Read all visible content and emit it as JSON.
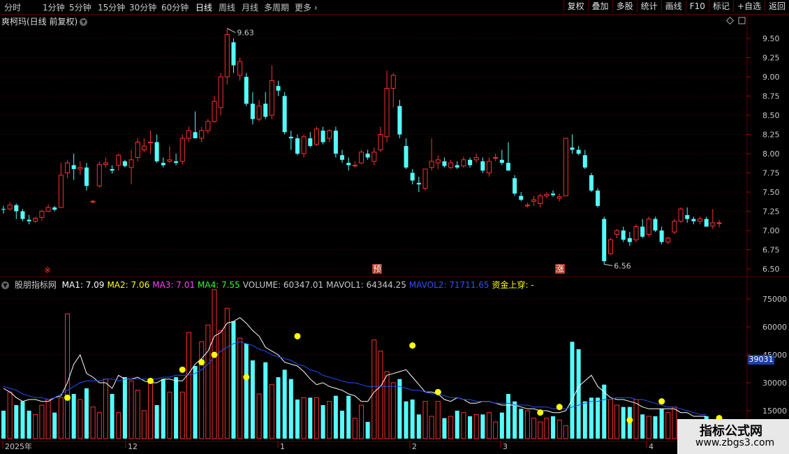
{
  "toolbar": {
    "periods": [
      "分时",
      "1分钟",
      "5分钟",
      "15分钟",
      "30分钟",
      "60分钟",
      "日线",
      "周线",
      "月线",
      "多周期",
      "更多"
    ],
    "active_period": "日线",
    "more_icon": "chevron-right-icon",
    "right_buttons": [
      "复权",
      "叠加",
      "多股",
      "统计",
      "画线",
      "F10",
      "标记",
      "+自选",
      "返回"
    ]
  },
  "main_chart": {
    "title": "爽柯玛(日线 前复权)",
    "title_icon": "chevron-down-icon",
    "high_label": "9.63",
    "low_label": "6.56",
    "price_ticks": [
      "9.50",
      "9.25",
      "9.00",
      "8.75",
      "8.50",
      "8.25",
      "8.00",
      "7.75",
      "7.50",
      "7.25",
      "7.00",
      "6.75",
      "6.50"
    ],
    "markers": [
      "※",
      "预",
      "涨"
    ]
  },
  "indicator": {
    "name": "股朋指标网",
    "values": [
      {
        "label": "MA1: 7.09",
        "color": "#ffffff"
      },
      {
        "label": "MA2: 7.06",
        "color": "#ffff00"
      },
      {
        "label": "MA3: 7.01",
        "color": "#ff40ff"
      },
      {
        "label": "MA4: 7.55",
        "color": "#30ff30"
      },
      {
        "label": "VOLUME: 60347.01",
        "color": "#c8c8c8"
      },
      {
        "label": "MAVOL1: 64344.25",
        "color": "#c8c8c8"
      },
      {
        "label": "MAVOL2: 71711.65",
        "color": "#3050ff"
      },
      {
        "label": "资金上穿: -",
        "color": "#ffff00"
      }
    ],
    "volume_ticks": [
      "75000",
      "60000",
      "45000",
      "30000",
      "15000"
    ],
    "current_badge": "39031"
  },
  "time_axis": [
    "2025年",
    "12",
    "1",
    "2",
    "3",
    "4"
  ],
  "watermark": {
    "title": "指标公式网",
    "url": "www.zbgs3.com"
  },
  "colors": {
    "up": "#ff3030",
    "down": "#54ffff",
    "grid": "#5a0000",
    "ma_white": "#ffffff",
    "ma_blue": "#2050ff",
    "dot": "#ffff00"
  },
  "chart_data": {
    "type": "candlestick",
    "candles": [
      {
        "o": 7.28,
        "h": 7.32,
        "l": 7.22,
        "c": 7.27
      },
      {
        "o": 7.28,
        "h": 7.37,
        "l": 7.26,
        "c": 7.33
      },
      {
        "o": 7.33,
        "h": 7.35,
        "l": 7.15,
        "c": 7.25
      },
      {
        "o": 7.25,
        "h": 7.28,
        "l": 7.12,
        "c": 7.15
      },
      {
        "o": 7.14,
        "h": 7.2,
        "l": 7.08,
        "c": 7.12
      },
      {
        "o": 7.12,
        "h": 7.18,
        "l": 7.1,
        "c": 7.16
      },
      {
        "o": 7.17,
        "h": 7.27,
        "l": 7.13,
        "c": 7.25
      },
      {
        "o": 7.25,
        "h": 7.34,
        "l": 7.24,
        "c": 7.3
      },
      {
        "o": 7.3,
        "h": 7.32,
        "l": 7.25,
        "c": 7.27
      },
      {
        "o": 7.3,
        "h": 7.88,
        "l": 7.3,
        "c": 7.72
      },
      {
        "o": 7.75,
        "h": 7.92,
        "l": 7.68,
        "c": 7.88
      },
      {
        "o": 7.85,
        "h": 8.0,
        "l": 7.66,
        "c": 7.8
      },
      {
        "o": 7.8,
        "h": 7.9,
        "l": 7.72,
        "c": 7.82
      },
      {
        "o": 7.82,
        "h": 7.88,
        "l": 7.52,
        "c": 7.58
      },
      {
        "o": 7.38,
        "h": 7.4,
        "l": 7.35,
        "c": 7.38
      },
      {
        "o": 7.58,
        "h": 7.9,
        "l": 7.56,
        "c": 7.86
      },
      {
        "o": 7.86,
        "h": 7.95,
        "l": 7.82,
        "c": 7.88
      },
      {
        "o": 7.8,
        "h": 7.85,
        "l": 7.74,
        "c": 7.78
      },
      {
        "o": 7.85,
        "h": 8.0,
        "l": 7.78,
        "c": 7.98
      },
      {
        "o": 7.9,
        "h": 7.92,
        "l": 7.82,
        "c": 7.84
      },
      {
        "o": 7.82,
        "h": 8.05,
        "l": 7.6,
        "c": 7.92
      },
      {
        "o": 7.95,
        "h": 8.2,
        "l": 7.9,
        "c": 8.15
      },
      {
        "o": 8.05,
        "h": 8.2,
        "l": 8.02,
        "c": 8.1
      },
      {
        "o": 8.15,
        "h": 8.3,
        "l": 8.0,
        "c": 8.15
      },
      {
        "o": 8.15,
        "h": 8.25,
        "l": 7.88,
        "c": 7.9
      },
      {
        "o": 7.88,
        "h": 7.95,
        "l": 7.82,
        "c": 7.85
      },
      {
        "o": 7.9,
        "h": 8.1,
        "l": 7.88,
        "c": 7.92
      },
      {
        "o": 7.9,
        "h": 8.0,
        "l": 7.85,
        "c": 7.88
      },
      {
        "o": 7.9,
        "h": 8.25,
        "l": 7.86,
        "c": 8.2
      },
      {
        "o": 8.2,
        "h": 8.35,
        "l": 8.15,
        "c": 8.3
      },
      {
        "o": 8.28,
        "h": 8.55,
        "l": 8.22,
        "c": 8.2
      },
      {
        "o": 8.2,
        "h": 8.35,
        "l": 8.15,
        "c": 8.3
      },
      {
        "o": 8.3,
        "h": 8.45,
        "l": 8.26,
        "c": 8.42
      },
      {
        "o": 8.42,
        "h": 8.75,
        "l": 8.4,
        "c": 8.68
      },
      {
        "o": 8.6,
        "h": 9.05,
        "l": 8.5,
        "c": 9.0
      },
      {
        "o": 9.0,
        "h": 9.63,
        "l": 8.9,
        "c": 9.55
      },
      {
        "o": 9.45,
        "h": 9.5,
        "l": 9.05,
        "c": 9.15
      },
      {
        "o": 9.02,
        "h": 9.25,
        "l": 8.95,
        "c": 9.2
      },
      {
        "o": 9.0,
        "h": 9.05,
        "l": 8.62,
        "c": 8.65
      },
      {
        "o": 8.65,
        "h": 8.8,
        "l": 8.38,
        "c": 8.45
      },
      {
        "o": 8.45,
        "h": 8.7,
        "l": 8.42,
        "c": 8.62
      },
      {
        "o": 8.65,
        "h": 8.8,
        "l": 8.45,
        "c": 8.48
      },
      {
        "o": 8.5,
        "h": 9.15,
        "l": 8.45,
        "c": 8.95
      },
      {
        "o": 8.88,
        "h": 8.95,
        "l": 8.75,
        "c": 8.82
      },
      {
        "o": 8.75,
        "h": 8.8,
        "l": 8.25,
        "c": 8.28
      },
      {
        "o": 8.22,
        "h": 8.3,
        "l": 8.05,
        "c": 8.2
      },
      {
        "o": 8.2,
        "h": 8.25,
        "l": 7.98,
        "c": 8.0
      },
      {
        "o": 8.0,
        "h": 8.25,
        "l": 7.95,
        "c": 8.22
      },
      {
        "o": 8.2,
        "h": 8.28,
        "l": 8.08,
        "c": 8.1
      },
      {
        "o": 8.12,
        "h": 8.35,
        "l": 8.1,
        "c": 8.32
      },
      {
        "o": 8.3,
        "h": 8.35,
        "l": 8.12,
        "c": 8.15
      },
      {
        "o": 8.2,
        "h": 8.32,
        "l": 8.15,
        "c": 8.3
      },
      {
        "o": 8.3,
        "h": 8.35,
        "l": 7.95,
        "c": 8.0
      },
      {
        "o": 7.98,
        "h": 8.05,
        "l": 7.88,
        "c": 7.92
      },
      {
        "o": 7.88,
        "h": 7.95,
        "l": 7.78,
        "c": 7.85
      },
      {
        "o": 7.85,
        "h": 7.9,
        "l": 7.82,
        "c": 7.85
      },
      {
        "o": 7.88,
        "h": 8.05,
        "l": 7.86,
        "c": 8.02
      },
      {
        "o": 8.0,
        "h": 8.05,
        "l": 7.92,
        "c": 7.95
      },
      {
        "o": 7.9,
        "h": 8.08,
        "l": 7.85,
        "c": 8.02
      },
      {
        "o": 8.05,
        "h": 8.35,
        "l": 8.02,
        "c": 8.25
      },
      {
        "o": 8.22,
        "h": 9.08,
        "l": 8.15,
        "c": 8.85
      },
      {
        "o": 8.85,
        "h": 9.05,
        "l": 8.6,
        "c": 9.02
      },
      {
        "o": 8.62,
        "h": 8.7,
        "l": 8.2,
        "c": 8.25
      },
      {
        "o": 8.1,
        "h": 8.2,
        "l": 7.8,
        "c": 7.82
      },
      {
        "o": 7.75,
        "h": 7.8,
        "l": 7.6,
        "c": 7.65
      },
      {
        "o": 7.62,
        "h": 7.7,
        "l": 7.5,
        "c": 7.6
      },
      {
        "o": 7.55,
        "h": 7.8,
        "l": 7.52,
        "c": 7.8
      },
      {
        "o": 7.82,
        "h": 8.2,
        "l": 7.78,
        "c": 7.9
      },
      {
        "o": 7.88,
        "h": 7.98,
        "l": 7.8,
        "c": 7.92
      },
      {
        "o": 7.9,
        "h": 7.95,
        "l": 7.82,
        "c": 7.84
      },
      {
        "o": 7.82,
        "h": 7.92,
        "l": 7.8,
        "c": 7.88
      },
      {
        "o": 7.85,
        "h": 7.9,
        "l": 7.8,
        "c": 7.82
      },
      {
        "o": 7.84,
        "h": 7.96,
        "l": 7.82,
        "c": 7.92
      },
      {
        "o": 7.92,
        "h": 7.95,
        "l": 7.82,
        "c": 7.85
      },
      {
        "o": 7.92,
        "h": 8.0,
        "l": 7.88,
        "c": 7.95
      },
      {
        "o": 7.9,
        "h": 7.95,
        "l": 7.75,
        "c": 7.78
      },
      {
        "o": 7.75,
        "h": 7.95,
        "l": 7.7,
        "c": 7.9
      },
      {
        "o": 7.95,
        "h": 8.0,
        "l": 7.9,
        "c": 7.95
      },
      {
        "o": 7.92,
        "h": 8.05,
        "l": 7.85,
        "c": 7.88
      },
      {
        "o": 7.88,
        "h": 8.15,
        "l": 7.78,
        "c": 7.78
      },
      {
        "o": 7.68,
        "h": 7.72,
        "l": 7.45,
        "c": 7.48
      },
      {
        "o": 7.45,
        "h": 7.5,
        "l": 7.38,
        "c": 7.4
      },
      {
        "o": 7.32,
        "h": 7.36,
        "l": 7.3,
        "c": 7.33
      },
      {
        "o": 7.38,
        "h": 7.45,
        "l": 7.32,
        "c": 7.4
      },
      {
        "o": 7.35,
        "h": 7.48,
        "l": 7.3,
        "c": 7.45
      },
      {
        "o": 7.45,
        "h": 7.5,
        "l": 7.42,
        "c": 7.47
      },
      {
        "o": 7.48,
        "h": 7.52,
        "l": 7.44,
        "c": 7.46
      },
      {
        "o": 7.42,
        "h": 7.48,
        "l": 7.38,
        "c": 7.44
      },
      {
        "o": 7.45,
        "h": 8.2,
        "l": 7.45,
        "c": 8.2
      },
      {
        "o": 8.08,
        "h": 8.25,
        "l": 8.0,
        "c": 8.05
      },
      {
        "o": 8.05,
        "h": 8.1,
        "l": 7.98,
        "c": 8.0
      },
      {
        "o": 7.98,
        "h": 8.05,
        "l": 7.8,
        "c": 7.82
      },
      {
        "o": 7.72,
        "h": 7.75,
        "l": 7.5,
        "c": 7.52
      },
      {
        "o": 7.52,
        "h": 7.55,
        "l": 7.3,
        "c": 7.32
      },
      {
        "o": 7.15,
        "h": 7.18,
        "l": 6.56,
        "c": 6.6
      },
      {
        "o": 6.7,
        "h": 6.9,
        "l": 6.68,
        "c": 6.88
      },
      {
        "o": 6.95,
        "h": 7.02,
        "l": 6.9,
        "c": 7.0
      },
      {
        "o": 7.0,
        "h": 7.05,
        "l": 6.85,
        "c": 6.88
      },
      {
        "o": 6.9,
        "h": 6.98,
        "l": 6.8,
        "c": 6.85
      },
      {
        "o": 6.88,
        "h": 7.08,
        "l": 6.85,
        "c": 7.05
      },
      {
        "o": 7.05,
        "h": 7.15,
        "l": 6.9,
        "c": 6.92
      },
      {
        "o": 6.95,
        "h": 7.18,
        "l": 6.92,
        "c": 7.15
      },
      {
        "o": 7.15,
        "h": 7.18,
        "l": 6.98,
        "c": 7.0
      },
      {
        "o": 7.0,
        "h": 7.05,
        "l": 6.82,
        "c": 6.85
      },
      {
        "o": 6.85,
        "h": 6.92,
        "l": 6.82,
        "c": 6.9
      },
      {
        "o": 6.98,
        "h": 7.15,
        "l": 6.95,
        "c": 7.12
      },
      {
        "o": 7.12,
        "h": 7.3,
        "l": 7.1,
        "c": 7.28
      },
      {
        "o": 7.2,
        "h": 7.3,
        "l": 7.1,
        "c": 7.15
      },
      {
        "o": 7.15,
        "h": 7.18,
        "l": 7.08,
        "c": 7.12
      },
      {
        "o": 7.12,
        "h": 7.18,
        "l": 7.08,
        "c": 7.15
      },
      {
        "o": 7.15,
        "h": 7.18,
        "l": 7.05,
        "c": 7.05
      },
      {
        "o": 7.06,
        "h": 7.28,
        "l": 7.02,
        "c": 7.1
      },
      {
        "o": 7.1,
        "h": 7.14,
        "l": 7.04,
        "c": 7.1
      }
    ],
    "volume": [
      15,
      25,
      18,
      20,
      15,
      13,
      18,
      21,
      14,
      22,
      67,
      24,
      21,
      27,
      17,
      14,
      32,
      24,
      14,
      33,
      31,
      26,
      15,
      32,
      18,
      32,
      25,
      33,
      25,
      57,
      39,
      52,
      61,
      80,
      58,
      70,
      63,
      54,
      51,
      42,
      24,
      41,
      29,
      33,
      37,
      32,
      21,
      22,
      22,
      22,
      18,
      20,
      23,
      15,
      23,
      11,
      18,
      9,
      53,
      47,
      36,
      30,
      32,
      20,
      21,
      13,
      20,
      12,
      20,
      11,
      12,
      15,
      14,
      12,
      13,
      13,
      14,
      9,
      14,
      24,
      20,
      16,
      15,
      11,
      9,
      11,
      12,
      10,
      7,
      52,
      48,
      20,
      22,
      22,
      29,
      21,
      18,
      17,
      17,
      21,
      13,
      12,
      12,
      16,
      14,
      17,
      9,
      10,
      9,
      7,
      12
    ],
    "mavol_white": [
      27,
      25,
      22,
      20,
      21,
      21,
      20,
      20,
      22,
      23,
      30,
      40,
      45,
      35,
      33,
      30,
      30,
      27,
      34,
      32,
      32,
      33,
      31,
      30,
      30,
      32,
      32,
      31,
      31,
      35,
      40,
      43,
      47,
      55,
      57,
      62,
      63,
      65,
      62,
      58,
      55,
      49,
      47,
      45,
      41,
      40,
      39,
      36,
      32,
      29,
      30,
      28,
      27,
      26,
      24,
      23,
      20,
      20,
      25,
      28,
      34,
      35,
      36,
      37,
      33,
      29,
      25,
      25,
      24,
      21,
      20,
      22,
      21,
      19,
      19,
      20,
      20,
      19,
      18,
      18,
      18,
      17,
      16,
      16,
      15,
      15,
      14,
      14,
      15,
      21,
      28,
      31,
      34,
      28,
      25,
      22,
      21,
      21,
      20,
      19,
      17,
      16,
      16,
      16,
      16,
      16,
      14,
      14,
      12,
      12,
      12
    ],
    "mavol_blue": [
      28,
      27,
      26,
      24,
      23,
      22,
      22,
      21,
      22,
      24,
      26,
      28,
      30,
      31,
      31,
      31,
      32,
      32,
      31,
      32,
      32,
      32,
      32,
      32,
      32,
      33,
      33,
      34,
      34,
      34,
      35,
      37,
      40,
      44,
      47,
      49,
      51,
      52,
      51,
      50,
      48,
      47,
      45,
      44,
      43,
      42,
      40,
      39,
      37,
      36,
      34,
      33,
      32,
      31,
      30,
      30,
      29,
      28,
      28,
      28,
      28,
      28,
      28,
      27,
      26,
      26,
      25,
      24,
      24,
      23,
      22,
      22,
      21,
      21,
      20,
      20,
      20,
      19,
      19,
      19,
      18,
      18,
      18,
      17,
      17,
      17,
      16,
      16,
      16,
      17,
      18,
      19,
      20,
      20,
      21,
      21,
      22,
      22,
      22,
      21,
      21,
      20,
      19,
      18,
      17,
      17,
      16,
      15,
      14,
      13,
      13
    ]
  }
}
